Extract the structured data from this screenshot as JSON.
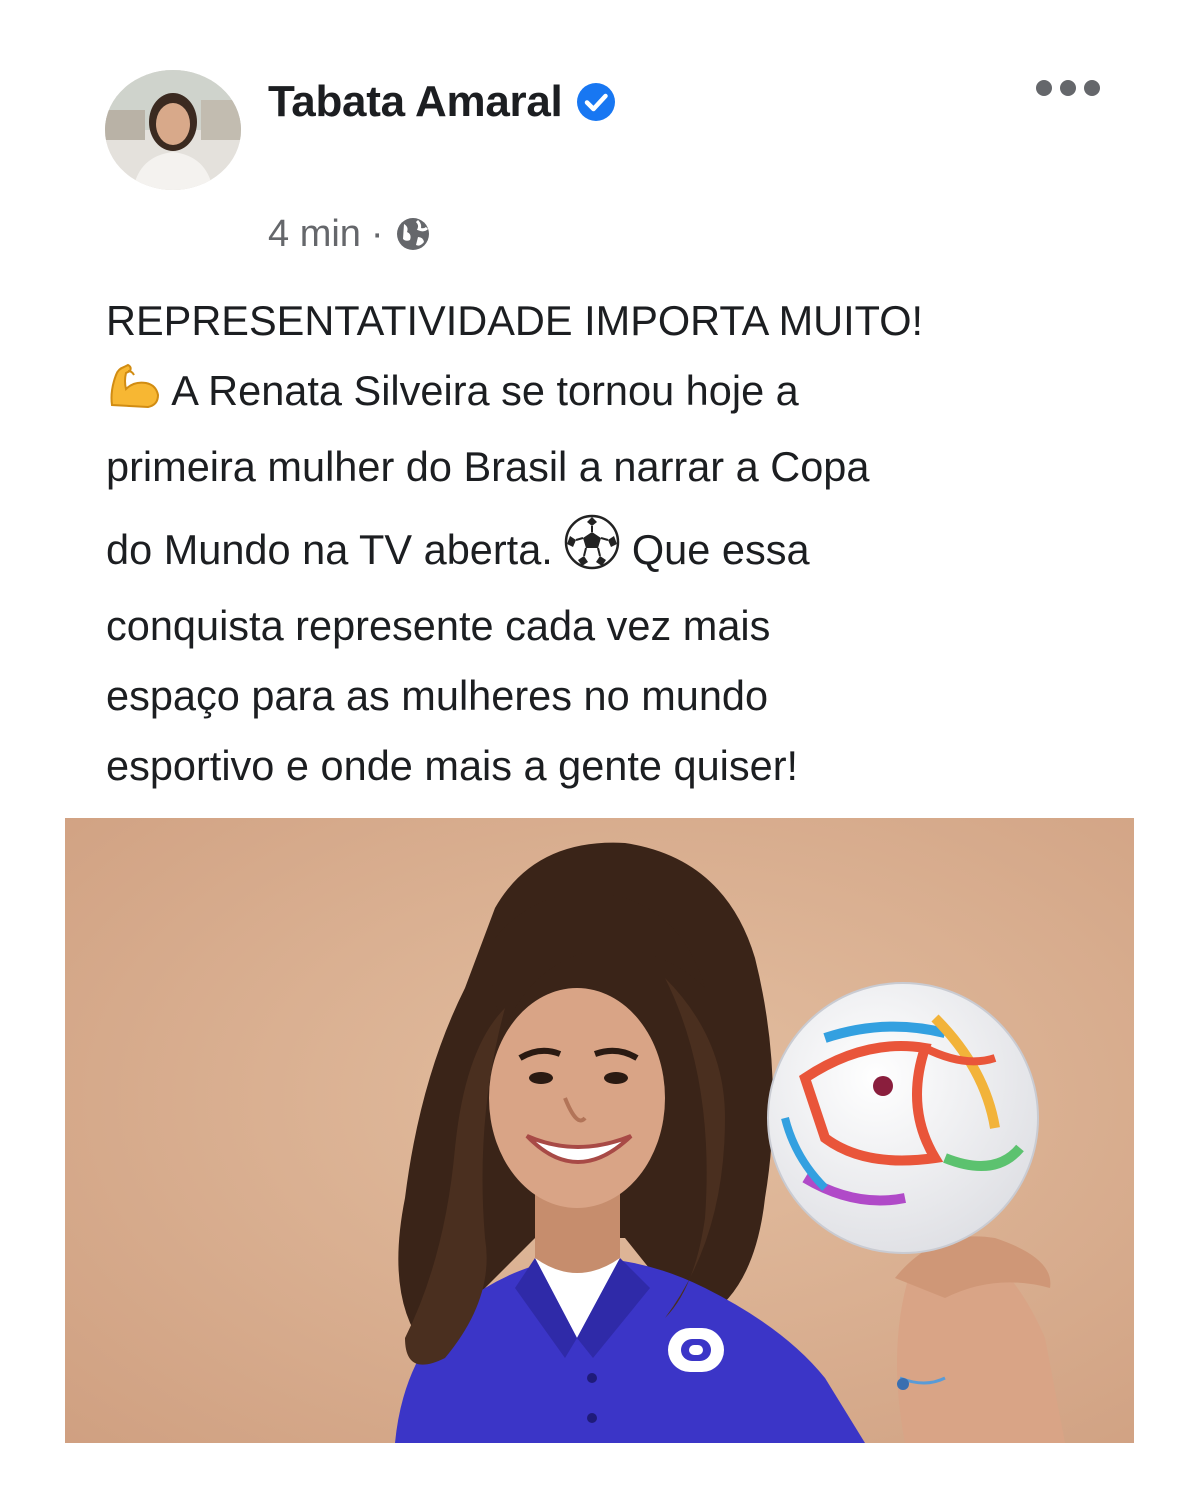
{
  "post": {
    "author": {
      "name": "Tabata Amaral",
      "verified": true,
      "avatar_icon": "profile-photo"
    },
    "meta": {
      "time": "4 min",
      "separator": "·",
      "privacy_icon": "globe-icon"
    },
    "more_icon": "ellipsis-icon",
    "text": {
      "headline": "REPRESENTATIVIDADE IMPORTA MUITO!",
      "line1": "A Renata Silveira se tornou hoje a",
      "line2": "primeira mulher do Brasil a narrar a Copa",
      "line3a": "do Mundo na TV aberta.",
      "line3b": "Que essa",
      "line4": "conquista represente cada vez mais",
      "line5": "espaço para as mulheres no mundo",
      "line6": "esportivo e onde mais a gente quiser!",
      "emoji_1": "flexed-biceps-emoji",
      "emoji_2": "soccer-ball-emoji"
    },
    "image": {
      "description_icon": "post-photo",
      "colors": {
        "background": "#d6ad8f",
        "shirt": "#3b35c7",
        "hair": "#3a2418"
      }
    }
  },
  "colors": {
    "verified_badge": "#1877f2",
    "secondary_text": "#65676b",
    "primary_text": "#1c1e21"
  }
}
